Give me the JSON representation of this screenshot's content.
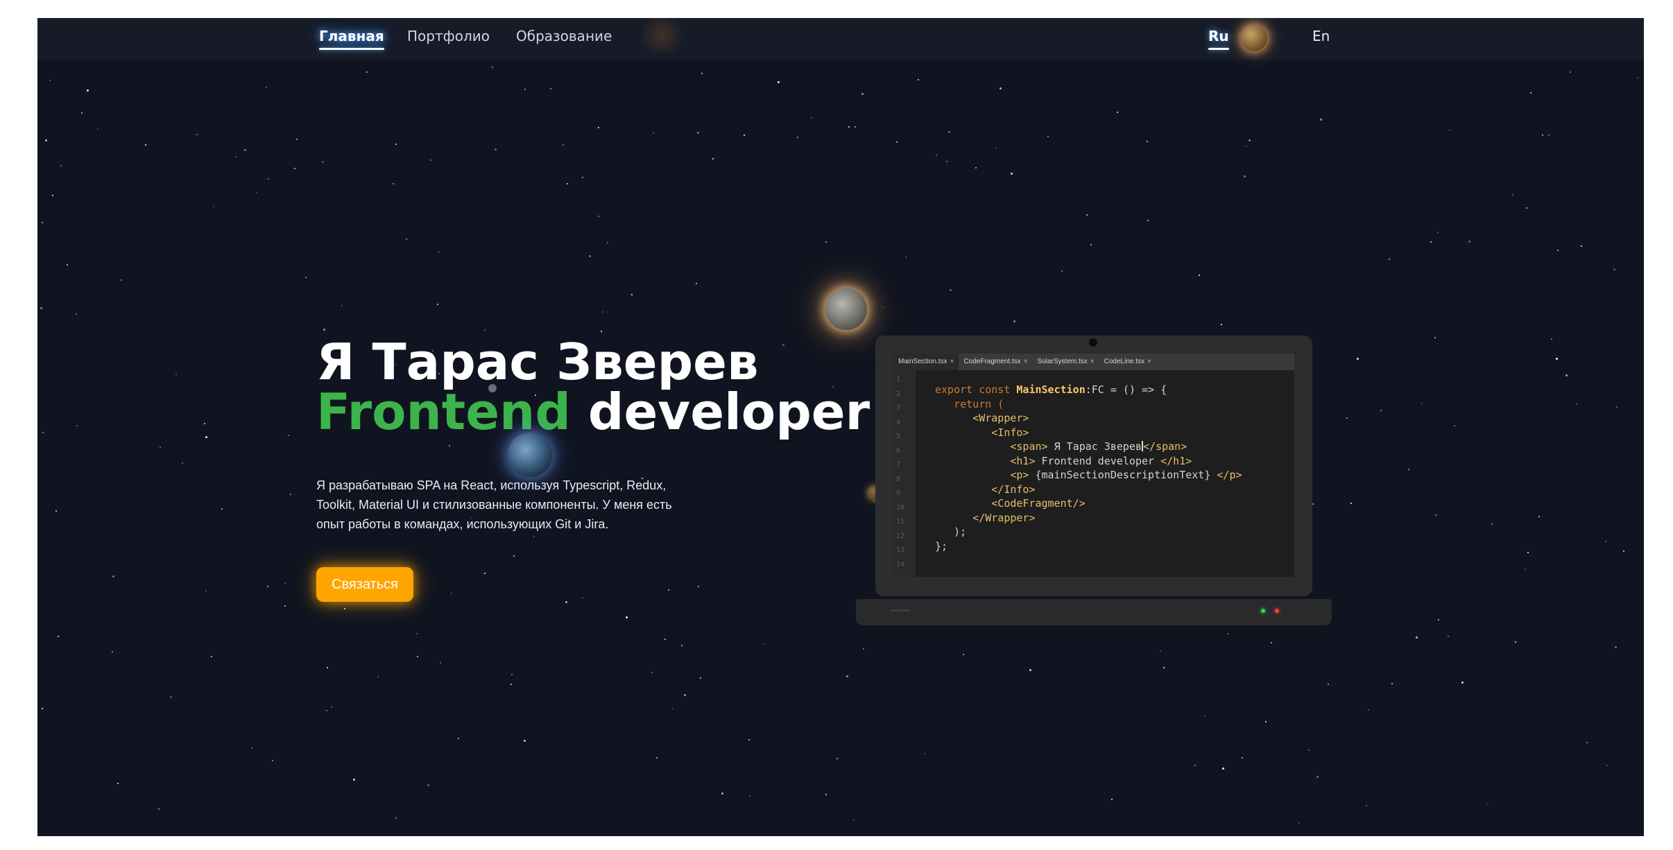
{
  "nav": {
    "items": [
      {
        "label": "Главная",
        "active": true
      },
      {
        "label": "Портфолио",
        "active": false
      },
      {
        "label": "Образование",
        "active": false
      }
    ]
  },
  "language": {
    "ru_label": "Ru",
    "en_label": "En",
    "active": "Ru",
    "toggle_icon": "planet-icon"
  },
  "hero": {
    "title_line1": "Я Тарас Зверев",
    "title_accent": "Frontend",
    "title_rest": " developer",
    "description": "Я разрабатываю SPA на React, используя Typescript, Redux, Toolkit, Material UI и стилизованные компоненты. У меня есть опыт работы в командах, использующих Git и Jira.",
    "contact_button": "Связаться"
  },
  "editor": {
    "tabs": [
      "MainSection.tsx",
      "CodeFragment.tsx",
      "SolarSystem.tsx",
      "CodeLine.tsx"
    ],
    "tab_close": "×",
    "line_numbers": [
      "1",
      "2",
      "3",
      "4",
      "5",
      "6",
      "7",
      "8",
      "9",
      "10",
      "11",
      "12",
      "13",
      "14"
    ],
    "code": {
      "l1_kw": "export const ",
      "l1_fn": "MainSection",
      "l1_rest": ":FC = () => {",
      "l2": "return (",
      "l3": "<Wrapper>",
      "l4": "<Info>",
      "l5_open": "<span>",
      "l5_text": " Я Тарас Зверев",
      "l5_close": "</span>",
      "l6_open": "<h1>",
      "l6_text": " Frontend developer ",
      "l6_close": "</h1>",
      "l7_open": "<p>",
      "l7_text": " {mainSectionDescriptionText} ",
      "l7_close": "</p>",
      "l8": "</Info>",
      "l9": "<CodeFragment/>",
      "l10": "</Wrapper>",
      "l11": ");",
      "l12": "};"
    }
  },
  "colors": {
    "background": "#101420",
    "accent_green": "#3cb44b",
    "button_orange": "#ffa500",
    "glow_blue": "#5aa8ff"
  }
}
